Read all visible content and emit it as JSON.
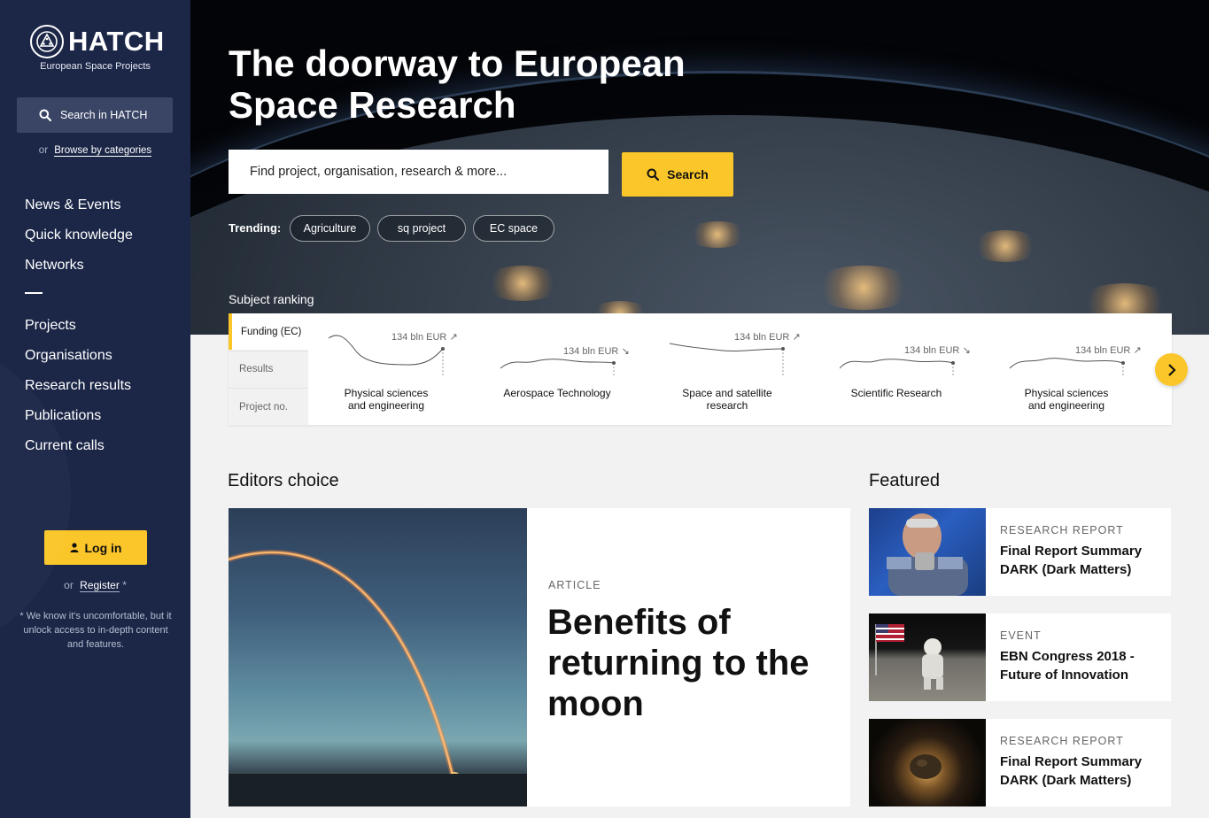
{
  "brand": {
    "name": "HATCH",
    "subtitle": "European Space Projects"
  },
  "sidebar": {
    "search_label": "Search in HATCH",
    "browse_prefix": "or",
    "browse_link": "Browse by categories",
    "nav_primary": [
      "News & Events",
      "Quick knowledge",
      "Networks"
    ],
    "nav_secondary": [
      "Projects",
      "Organisations",
      "Research results",
      "Publications",
      "Current calls"
    ],
    "login_label": "Log in",
    "register_prefix": "or",
    "register_link": "Register",
    "register_mark": "*",
    "note": "* We know it's uncomfortable, but it unlock access to in-depth content and features."
  },
  "hero": {
    "title": "The doorway to European Space Research",
    "search_placeholder": "Find project, organisation, research & more...",
    "search_button": "Search",
    "trending_label": "Trending:",
    "trending": [
      "Agriculture",
      "sq project",
      "EC space"
    ],
    "subject_ranking_label": "Subject ranking"
  },
  "ranking": {
    "tabs": [
      "Funding (EC)",
      "Results",
      "Project no."
    ],
    "active_tab": "Funding (EC)",
    "items": [
      {
        "value": "134 bln EUR",
        "trend": "up",
        "arrow": "↗",
        "name_lines": [
          "Physical sciences",
          "and engineering"
        ]
      },
      {
        "value": "134 bln EUR",
        "trend": "down",
        "arrow": "↘",
        "name_lines": [
          "Aerospace Technology",
          ""
        ]
      },
      {
        "value": "134 bln EUR",
        "trend": "up",
        "arrow": "↗",
        "name_lines": [
          "Space and satellite",
          "research"
        ]
      },
      {
        "value": "134 bln EUR",
        "trend": "down",
        "arrow": "↘",
        "name_lines": [
          "Scientific Research",
          ""
        ]
      },
      {
        "value": "134 bln EUR",
        "trend": "up",
        "arrow": "↗",
        "name_lines": [
          "Physical sciences",
          "and engineering"
        ]
      }
    ]
  },
  "editors_choice": {
    "heading": "Editors choice",
    "kicker": "ARTICLE",
    "title": "Benefits of returning to the moon"
  },
  "featured": {
    "heading": "Featured",
    "items": [
      {
        "kicker": "RESEARCH REPORT",
        "title": "Final Report Summary DARK (Dark Matters)"
      },
      {
        "kicker": "EVENT",
        "title": "EBN Congress 2018 - Future of Innovation"
      },
      {
        "kicker": "RESEARCH REPORT",
        "title": "Final Report Summary DARK (Dark Matters)"
      }
    ]
  },
  "colors": {
    "sidebar_bg": "#1c2748",
    "accent": "#fbc629",
    "page_bg": "#f2f2f2"
  }
}
